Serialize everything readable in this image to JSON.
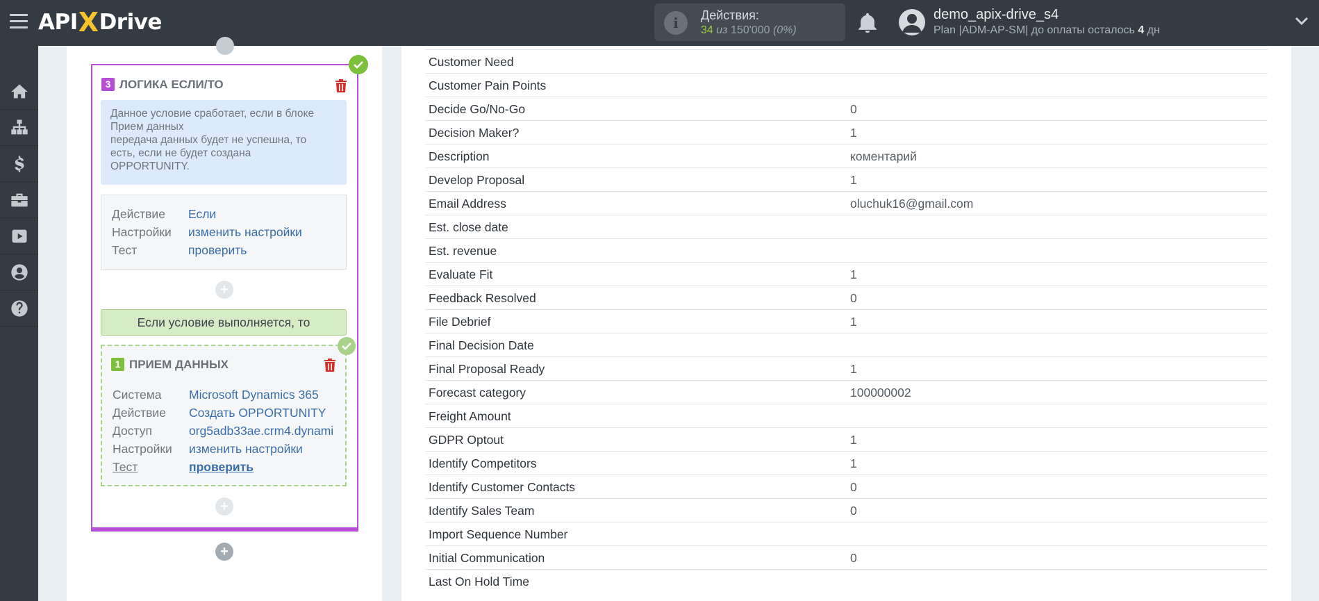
{
  "header": {
    "logo": {
      "prefix": "API",
      "x": "X",
      "suffix": "Drive"
    },
    "actions": {
      "title": "Действия:",
      "used": "34",
      "separator": " из ",
      "total": "150'000",
      "percent": "(0%)"
    },
    "user": {
      "name": "demo_apix-drive_s4",
      "plan_prefix": "Plan |ADM-AP-SM| до оплаты осталось ",
      "days": "4",
      "days_unit": " дн"
    }
  },
  "sidebar": {
    "items": [
      {
        "icon": "home-icon"
      },
      {
        "icon": "sitemap-icon"
      },
      {
        "icon": "dollar-icon"
      },
      {
        "icon": "briefcase-icon"
      },
      {
        "icon": "youtube-icon"
      },
      {
        "icon": "user-icon"
      },
      {
        "icon": "help-icon"
      }
    ]
  },
  "logic_block": {
    "number": "3",
    "title": "ЛОГИКА ЕСЛИ/ТО",
    "note": [
      "Данное условие сработает, если в блоке",
      "Прием данных",
      "передача данных будет не успешна, то",
      "есть, если не будет создана",
      "OPPORTUNITY."
    ],
    "props": [
      {
        "key": "Действие",
        "value": "Если"
      },
      {
        "key": "Настройки",
        "value": "изменить настройки"
      },
      {
        "key": "Тест",
        "value": "проверить"
      }
    ],
    "condition": "Если условие выполняется, то"
  },
  "receive_block": {
    "number": "1",
    "title": "ПРИЕМ ДАННЫХ",
    "props": [
      {
        "key": "Система",
        "value": "Microsoft Dynamics 365"
      },
      {
        "key": "Действие",
        "value": "Создать OPPORTUNITY"
      },
      {
        "key": "Доступ",
        "value": "org5adb33ae.crm4.dynami"
      },
      {
        "key": "Настройки",
        "value": "изменить настройки"
      },
      {
        "key": "Тест",
        "value": "проверить"
      }
    ]
  },
  "plus_label": "+",
  "fields": [
    {
      "name": "Customer Need",
      "value": ""
    },
    {
      "name": "Customer Pain Points",
      "value": ""
    },
    {
      "name": "Decide Go/No-Go",
      "value": "0"
    },
    {
      "name": "Decision Maker?",
      "value": "1"
    },
    {
      "name": "Description",
      "value": "коментарий"
    },
    {
      "name": "Develop Proposal",
      "value": "1"
    },
    {
      "name": "Email Address",
      "value": "oluchuk16@gmail.com"
    },
    {
      "name": "Est. close date",
      "value": ""
    },
    {
      "name": "Est. revenue",
      "value": ""
    },
    {
      "name": "Evaluate Fit",
      "value": "1"
    },
    {
      "name": "Feedback Resolved",
      "value": "0"
    },
    {
      "name": "File Debrief",
      "value": "1"
    },
    {
      "name": "Final Decision Date",
      "value": ""
    },
    {
      "name": "Final Proposal Ready",
      "value": "1"
    },
    {
      "name": "Forecast category",
      "value": "100000002"
    },
    {
      "name": "Freight Amount",
      "value": ""
    },
    {
      "name": "GDPR Optout",
      "value": "1"
    },
    {
      "name": "Identify Competitors",
      "value": "1"
    },
    {
      "name": "Identify Customer Contacts",
      "value": "0"
    },
    {
      "name": "Identify Sales Team",
      "value": "0"
    },
    {
      "name": "Import Sequence Number",
      "value": ""
    },
    {
      "name": "Initial Communication",
      "value": "0"
    },
    {
      "name": "Last On Hold Time",
      "value": ""
    }
  ],
  "colors": {
    "accent_purple": "#b54dd6",
    "success_green": "#7bbf3a",
    "link_blue": "#3a6eaa",
    "topbar": "#343b43"
  }
}
